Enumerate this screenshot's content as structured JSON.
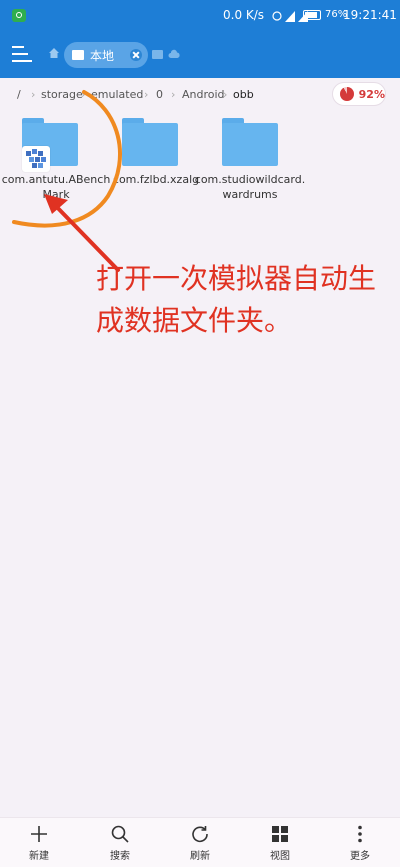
{
  "status_bar": {
    "network_speed": "0.0 K/s",
    "battery_percent": "76%",
    "time": "19:21:41"
  },
  "top_bar": {
    "current_tab": "本地"
  },
  "breadcrumb": {
    "segments": [
      "/",
      "storage",
      "emulated",
      "0",
      "Android",
      "obb"
    ]
  },
  "storage_usage": {
    "label": "92%",
    "value": 92
  },
  "folders": [
    {
      "name": "com.antutu.ABenchMark",
      "has_app_badge": true
    },
    {
      "name": "com.fzlbd.xzalg",
      "has_app_badge": false
    },
    {
      "name": "com.studiowildcard.wardrums",
      "has_app_badge": false
    }
  ],
  "annotation": {
    "text": "打开一次模拟器自动生成数据文件夹。",
    "color": "#e03222"
  },
  "bottom_bar": {
    "items": [
      {
        "label": "新建",
        "icon": "plus-icon"
      },
      {
        "label": "搜索",
        "icon": "search-icon"
      },
      {
        "label": "刷新",
        "icon": "refresh-icon"
      },
      {
        "label": "视图",
        "icon": "grid-view-icon"
      },
      {
        "label": "更多",
        "icon": "more-icon"
      }
    ]
  },
  "colors": {
    "primary": "#1e7ed6",
    "folder": "#66b5ef",
    "background": "#f5f1f7"
  }
}
